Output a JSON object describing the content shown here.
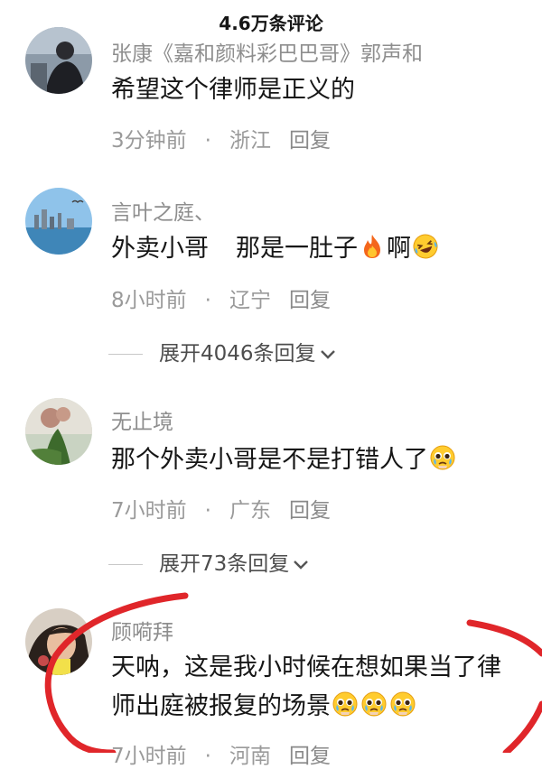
{
  "header": {
    "title": "4.6万条评论"
  },
  "comments": [
    {
      "username": "张康《嘉和颜料彩巴巴哥》郭声和",
      "text": "希望这个律师是正义的",
      "time": "3分钟前",
      "location": "浙江",
      "reply": "回复"
    },
    {
      "username": "言叶之庭、",
      "text_a": "外卖小哥",
      "text_b": "那是一肚子",
      "text_c": "啊",
      "emoji": [
        "fire-emoji",
        "laughing-tears-emoji"
      ],
      "time": "8小时前",
      "location": "辽宁",
      "reply": "回复",
      "expand": "展开4046条回复"
    },
    {
      "username": "无止境",
      "text": "那个外卖小哥是不是打错人了",
      "emoji": [
        "pleading-face-emoji"
      ],
      "time": "7小时前",
      "location": "广东",
      "reply": "回复",
      "expand": "展开73条回复"
    },
    {
      "username": "顾嗬拜",
      "text_line1": "天呐，这是我小时候在想如果当了律",
      "text_line2": "师出庭被报复的场景",
      "emoji": [
        "pleading-face-emoji",
        "pleading-face-emoji",
        "pleading-face-emoji"
      ],
      "time": "7小时前",
      "location": "河南",
      "reply": "回复"
    }
  ],
  "colors": {
    "text": "#161616",
    "secondary": "#8e8e8e",
    "annotation": "#e0262a"
  }
}
